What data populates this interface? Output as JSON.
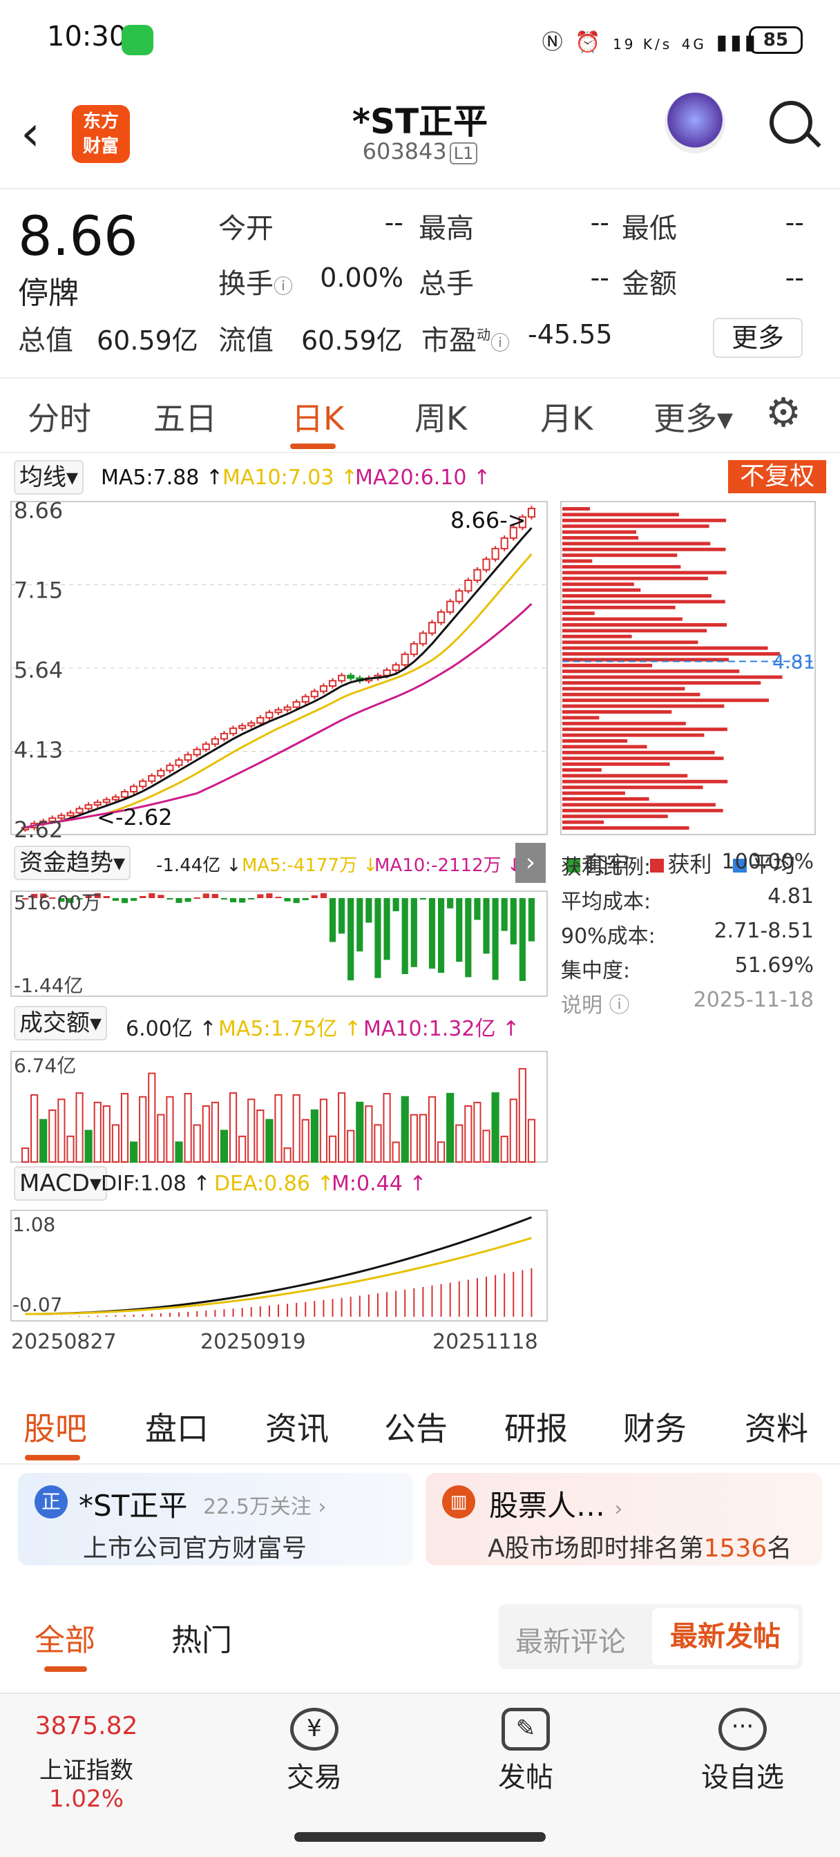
{
  "status": {
    "time": "10:30",
    "net": "19 K/s",
    "sig": "4G",
    "battery": "85"
  },
  "header": {
    "back": "‹",
    "logo_l1": "东方",
    "logo_l2": "财富",
    "name": "*ST正平",
    "code": "603843",
    "level": "L1"
  },
  "quote": {
    "price": "8.66",
    "status": "停牌",
    "open_label": "今开",
    "open_val": "--",
    "high_label": "最高",
    "high_val": "--",
    "low_label": "最低",
    "low_val": "--",
    "turnover_label": "换手",
    "turnover_val": "0.00%",
    "vol_label": "总手",
    "vol_val": "--",
    "amount_label": "金额",
    "amount_val": "--",
    "mcap_label": "总值",
    "mcap_val": "60.59亿",
    "float_label": "流值",
    "float_val": "60.59亿",
    "pe_label": "市盈",
    "pe_sup": "动",
    "pe_val": "-45.55",
    "more": "更多"
  },
  "period_tabs": [
    "分时",
    "五日",
    "日K",
    "周K",
    "月K",
    "更多▾"
  ],
  "indicators": {
    "ma_label": "均线▾",
    "ma5": "MA5:7.88 ↑",
    "ma10": "MA10:7.03 ↑",
    "ma20": "MA20:6.10 ↑",
    "fq": "不复权",
    "fund_label": "资金趋势▾",
    "fund_main": "-1.44亿 ↓",
    "fund_ma5": "MA5:-4177万 ↓",
    "fund_ma10": "MA10:-2112万 ↓",
    "amt_label": "成交额▾",
    "amt_main": "6.00亿 ↑",
    "amt_ma5": "MA5:1.75亿 ↑",
    "amt_ma10": "MA10:1.32亿 ↑",
    "macd_label": "MACD▾",
    "dif": "DIF:1.08 ↑",
    "dea": "DEA:0.86 ↑",
    "m": "M:0.44 ↑"
  },
  "chart_data": {
    "type": "candlestick",
    "y_ticks": [
      "8.66",
      "7.15",
      "5.64",
      "4.13",
      "2.62"
    ],
    "price_range": [
      2.62,
      8.66
    ],
    "last_label": "8.66->",
    "low_label": "<-2.62",
    "fund_ticks": [
      "516.00万",
      "-1.44亿"
    ],
    "amt_ticks": [
      "6.74亿"
    ],
    "macd_ticks": [
      "1.08",
      "-0.07"
    ],
    "x_ticks": [
      "20250827",
      "20250919",
      "20251118"
    ],
    "close": [
      2.62,
      2.7,
      2.74,
      2.8,
      2.85,
      2.9,
      2.98,
      3.05,
      3.1,
      3.15,
      3.2,
      3.3,
      3.4,
      3.5,
      3.6,
      3.7,
      3.8,
      3.9,
      4.0,
      4.1,
      4.2,
      4.3,
      4.4,
      4.5,
      4.55,
      4.6,
      4.7,
      4.8,
      4.85,
      4.9,
      5.0,
      5.1,
      5.2,
      5.3,
      5.4,
      5.5,
      5.45,
      5.4,
      5.45,
      5.5,
      5.6,
      5.7,
      5.9,
      6.1,
      6.3,
      6.5,
      6.7,
      6.9,
      7.1,
      7.3,
      7.5,
      7.7,
      7.9,
      8.1,
      8.3,
      8.5,
      8.66
    ],
    "chip_avg": "4.81"
  },
  "chips": {
    "legend_trap": "套牢",
    "legend_profit": "获利",
    "legend_avg": "平均",
    "rows": [
      {
        "k": "获利比例:",
        "v": "100.00%"
      },
      {
        "k": "平均成本:",
        "v": "4.81"
      },
      {
        "k": "90%成本:",
        "v": "2.71-8.51"
      },
      {
        "k": "集中度:",
        "v": "51.69%"
      },
      {
        "k": "说明",
        "v": "2025-11-18"
      }
    ]
  },
  "bottom_tabs": [
    "股吧",
    "盘口",
    "资讯",
    "公告",
    "研报",
    "财务",
    "资料"
  ],
  "cards": {
    "c1_title": "*ST正平",
    "c1_follow": "22.5万关注",
    "c1_sub": "上市公司官方财富号",
    "c2_title": "股票人…",
    "c2_sub_pre": "A股市场即时排名第",
    "c2_rank": "1536",
    "c2_sub_post": "名"
  },
  "sub_tabs": {
    "all": "全部",
    "hot": "热门",
    "latest_comment": "最新评论",
    "latest_post": "最新发帖"
  },
  "bottombar": {
    "index_val": "3875.82",
    "index_name": "上证指数",
    "index_chg": "1.02%",
    "trade": "交易",
    "post": "发帖",
    "watch": "设自选"
  }
}
